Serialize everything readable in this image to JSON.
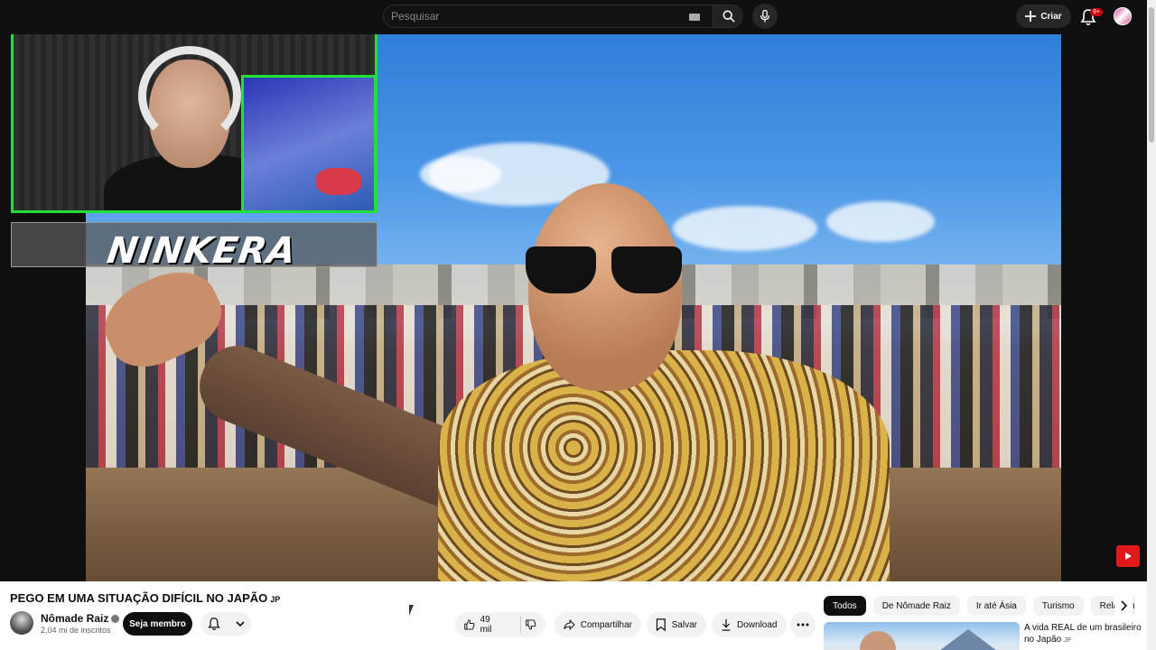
{
  "search": {
    "placeholder": "Pesquisar"
  },
  "header": {
    "create_label": "Criar",
    "notifications_badge": "9+"
  },
  "overlay": {
    "streamer_tag": "NINKERA"
  },
  "video": {
    "title": "PEGO EM UMA SITUAÇÃO DIFÍCIL NO JAPÃO",
    "title_flag": "JP",
    "channel_name": "Nômade Raiz",
    "subscribers": "2,04 mi de inscritos",
    "member_label": "Seja membro",
    "likes": "49 mil",
    "share_label": "Compartilhar",
    "save_label": "Salvar",
    "download_label": "Download"
  },
  "sidebar": {
    "chips": [
      "Todos",
      "De Nômade Raiz",
      "Ir até Ásia",
      "Turismo",
      "Relacionad"
    ],
    "recommendation": {
      "title": "A vida REAL de um brasileiro no Japão",
      "flag": "JP"
    }
  },
  "colors": {
    "accent": "#cc0000",
    "webcam_border": "#22e03a",
    "topbar": "#0f0f0f"
  },
  "icons": [
    "search-icon",
    "keyboard-icon",
    "mic-icon",
    "plus-icon",
    "bell-icon",
    "thumbs-up-icon",
    "thumbs-down-icon",
    "share-icon",
    "bookmark-icon",
    "download-icon",
    "more-icon",
    "chevron-right-icon",
    "chevron-down-icon",
    "youtube-icon",
    "verified-icon"
  ]
}
